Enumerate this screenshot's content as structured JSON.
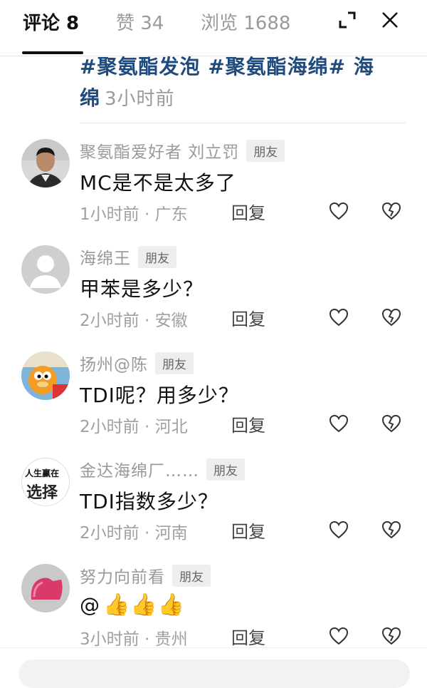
{
  "tabs": [
    {
      "label": "评论 8",
      "active": true
    },
    {
      "label": "赞 34",
      "active": false
    },
    {
      "label": "浏览 1688",
      "active": false
    }
  ],
  "header_icons": {
    "expand": "expand-icon",
    "close": "close-icon"
  },
  "post": {
    "hashtags": "#聚氨酯发泡 #聚氨酯海绵# 海绵",
    "time": "3小时前"
  },
  "comments": [
    {
      "name": "聚氨酯爱好者  刘立罚",
      "badge": "朋友",
      "text": "MC是不是太多了",
      "meta": "1小时前 · 广东",
      "reply": "回复",
      "avatar": "person-photo"
    },
    {
      "name": "海绵王",
      "badge": "朋友",
      "text": "甲苯是多少？",
      "meta": "2小时前 · 安徽",
      "reply": "回复",
      "avatar": "default-avatar"
    },
    {
      "name": "扬州@陈",
      "badge": "朋友",
      "text": "TDI呢？用多少？",
      "meta": "2小时前 · 河北",
      "reply": "回复",
      "avatar": "cartoon-cat"
    },
    {
      "name": "金达海绵厂……",
      "badge": "朋友",
      "text": "TDI指数多少？",
      "meta": "2小时前 · 河南",
      "reply": "回复",
      "avatar": "text-logo",
      "avatar_text_top": "人生赢在",
      "avatar_text_bottom": "选择"
    },
    {
      "name": "努力向前看",
      "badge": "朋友",
      "text": "@",
      "meta": "3小时前 · 贵州",
      "reply": "回复",
      "avatar": "pink-object",
      "emoji": "👍👍👍"
    }
  ]
}
